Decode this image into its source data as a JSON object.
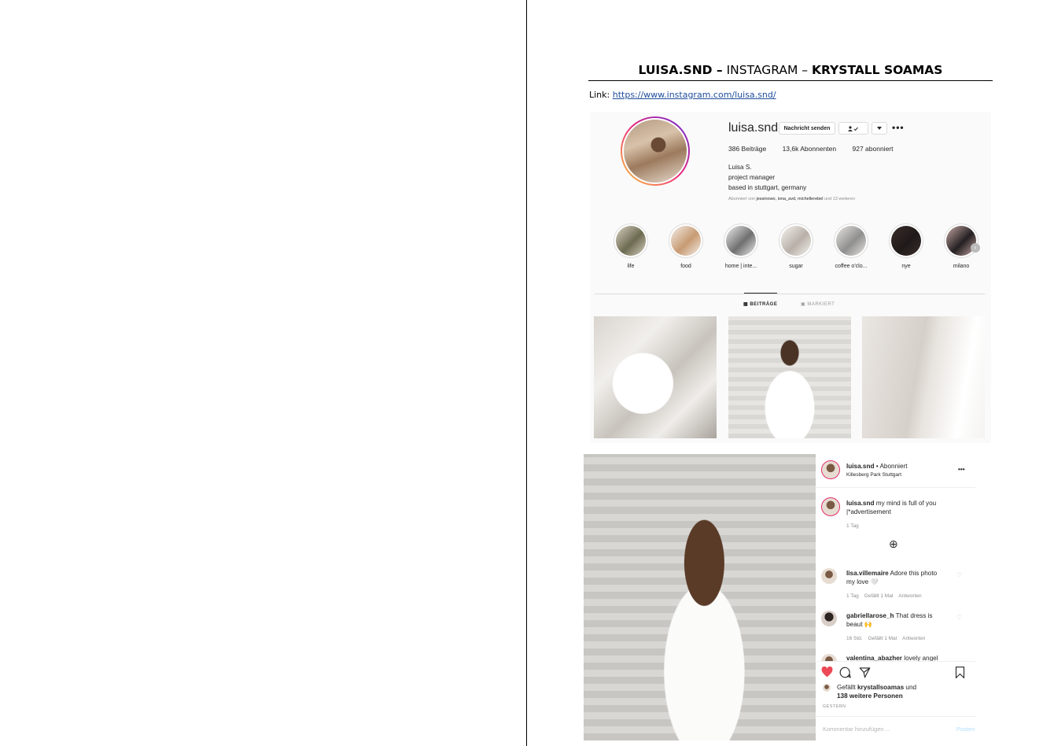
{
  "document": {
    "title_bold_left": "LUISA.SND –",
    "title_mid": " INSTAGRAM – ",
    "title_bold_right": "KRYSTALL SOAMAS",
    "link_label": "Link: ",
    "link_url": "https://www.instagram.com/luisa.snd/"
  },
  "profile": {
    "username": "luisa.snd",
    "message_button": "Nachricht senden",
    "follow_icon": "person-check-icon",
    "dropdown_icon": "caret-down-icon",
    "more_icon": "•••",
    "stats": {
      "posts": "386 Beiträge",
      "followers": "13,6k Abonnenten",
      "following": "927 abonniert"
    },
    "bio": {
      "name": "Luisa S.",
      "line1": "project manager",
      "line2": "based in stuttgart, germany"
    },
    "followed_by": {
      "prefix": "Abonniert von ",
      "users": "jessinowo, iona_avd, michellerebel",
      "suffix": " und 13 weiteren"
    },
    "highlights": [
      {
        "label": "life",
        "color_a": "#6d6a52",
        "color_b": "#d8d1c0"
      },
      {
        "label": "food",
        "color_a": "#c79a72",
        "color_b": "#f3efe9"
      },
      {
        "label": "home | inte...",
        "color_a": "#6f6f6f",
        "color_b": "#eeeeee"
      },
      {
        "label": "sugar",
        "color_a": "#b8b0a8",
        "color_b": "#f6f3ef"
      },
      {
        "label": "coffee o'clo...",
        "color_a": "#8f8f8f",
        "color_b": "#e7e5e2"
      },
      {
        "label": "nye",
        "color_a": "#1f1a19",
        "color_b": "#3a2e2b"
      },
      {
        "label": "milano",
        "color_a": "#241f22",
        "color_b": "#c7a9a4"
      }
    ],
    "tabs": {
      "posts": "▦ BEITRÄGE",
      "tagged": "▣ MARKIERT"
    }
  },
  "post": {
    "header_user": "luisa.snd",
    "header_follow": " • Abonniert",
    "location": "Killesberg Park Stuttgart",
    "more_icon": "•••",
    "caption_user": "luisa.snd",
    "caption_text": " my mind is full of you |*advertisement",
    "caption_time": "1 Tag",
    "load_more_icon": "⊕",
    "comments": [
      {
        "user": "lisa.villemaire",
        "text": " Adore this photo my love 🤍",
        "time": "1 Tag",
        "likes": "Gefällt 1 Mal",
        "reply": "Antworten"
      },
      {
        "user": "gabriellarose_h",
        "text": " That dress is beaut 🙌",
        "time": "16 Std.",
        "likes": "Gefällt 1 Mal",
        "reply": "Antworten"
      },
      {
        "user": "valentina_abazher",
        "text": " lovely angel"
      }
    ],
    "liked_prefix": "Gefällt ",
    "liked_user": "krystallsoamas",
    "liked_mid": " und",
    "liked_others": "138 weitere Personen",
    "date": "GESTERN",
    "comment_placeholder": "Kommentar hinzufügen ...",
    "post_button": "Posten",
    "icons": {
      "like": "heart-icon",
      "comment": "comment-icon",
      "share": "share-icon",
      "save": "bookmark-icon"
    },
    "like_color": "#ed4956"
  }
}
